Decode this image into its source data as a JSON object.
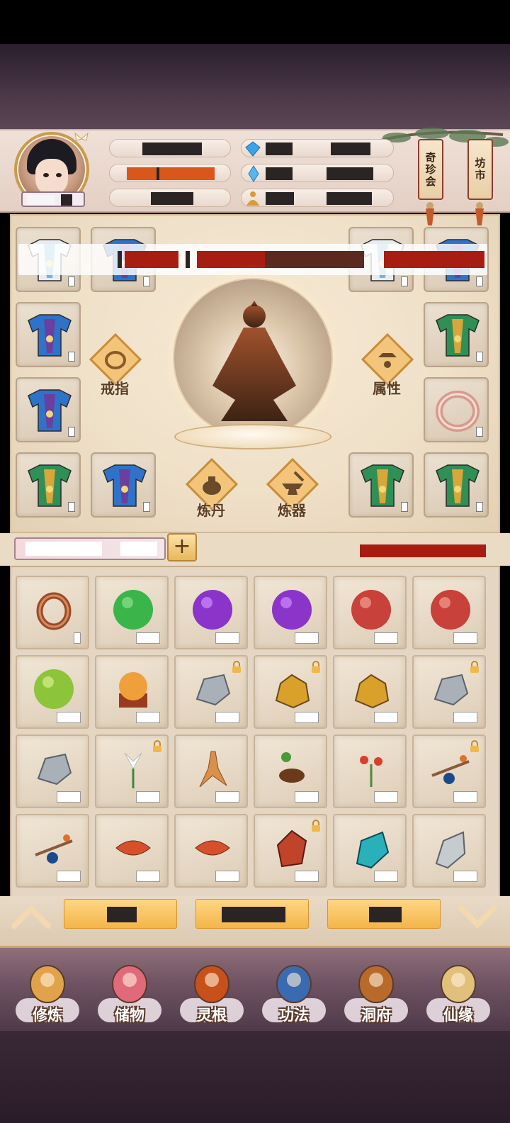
{
  "header": {
    "side_tags": [
      {
        "label": "奇珍会"
      },
      {
        "label": "坊市"
      }
    ]
  },
  "equipment": {
    "left_actions": {
      "ring_label": "戒指"
    },
    "right_actions": {
      "attribute_label": "属性"
    },
    "bottom_actions": {
      "alchemy_label": "炼丹",
      "forge_label": "炼器"
    }
  },
  "inventory": {
    "rows": [
      [
        "ring",
        "green-orb",
        "purple-orb",
        "purple-orb",
        "red-orb",
        "red-orb"
      ],
      [
        "lime-orb",
        "orange-orb-stand",
        "silver-ore",
        "gold-ore",
        "gold-ore",
        "silver-ore"
      ],
      [
        "silver-ore",
        "white-lily",
        "ginseng-root",
        "herb-root",
        "red-flower-herb",
        "berry-branch"
      ],
      [
        "berry-branch",
        "cordyceps",
        "cordyceps",
        "red-crystal",
        "blue-crystal",
        "silver-crystal"
      ]
    ],
    "locked": [
      [
        false,
        false,
        false,
        false,
        false,
        false
      ],
      [
        false,
        false,
        true,
        true,
        false,
        true
      ],
      [
        false,
        true,
        false,
        false,
        false,
        true
      ],
      [
        false,
        false,
        false,
        true,
        false,
        false
      ]
    ]
  },
  "nav": {
    "items": [
      {
        "label": "修炼",
        "icon": "cultivation-icon"
      },
      {
        "label": "储物",
        "icon": "storage-bag-icon"
      },
      {
        "label": "灵根",
        "icon": "spirit-root-icon"
      },
      {
        "label": "功法",
        "icon": "technique-book-icon"
      },
      {
        "label": "洞府",
        "icon": "cave-dwelling-icon"
      },
      {
        "label": "仙缘",
        "icon": "gourd-icon"
      }
    ]
  },
  "colors": {
    "accent_gold": "#f3b54a",
    "panel": "#e4d6c2",
    "nav": "#6e5261",
    "redaction_red": "#a81d12"
  }
}
